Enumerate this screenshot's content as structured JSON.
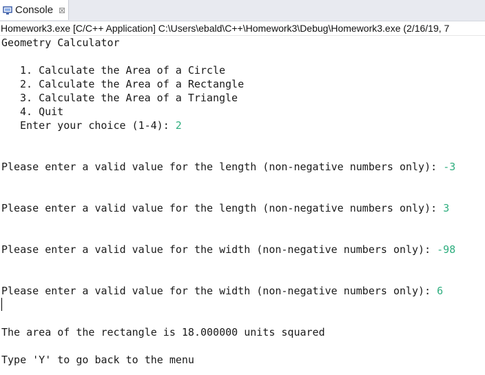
{
  "tab": {
    "label": "Console",
    "icon": "console-monitor-icon",
    "close_glyph": "⊠"
  },
  "status_line": "Homework3.exe [C/C++ Application] C:\\Users\\ebald\\C++\\Homework3\\Debug\\Homework3.exe (2/16/19, 7",
  "console": {
    "title": "Geometry Calculator",
    "menu": [
      "1. Calculate the Area of a Circle",
      "2. Calculate the Area of a Rectangle",
      "3. Calculate the Area of a Triangle",
      "4. Quit"
    ],
    "choice_prompt": "Enter your choice (1-4): ",
    "choice_value": "2",
    "prompts": [
      {
        "text": "Please enter a valid value for the length (non-negative numbers only): ",
        "value": "-3"
      },
      {
        "text": "Please enter a valid value for the length (non-negative numbers only): ",
        "value": "3"
      },
      {
        "text": "Please enter a valid value for the width (non-negative numbers only): ",
        "value": "-98"
      },
      {
        "text": "Please enter a valid value for the width (non-negative numbers only): ",
        "value": "6"
      }
    ],
    "result": "The area of the rectangle is 18.000000 units squared",
    "menu_return": "Type 'Y' to go back to the menu"
  },
  "colors": {
    "input_text": "#2fae7f",
    "tab_bar": "#e8eaf0"
  }
}
